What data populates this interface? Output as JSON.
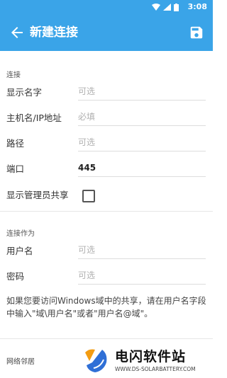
{
  "status_bar": {
    "time": "3:08"
  },
  "app_bar": {
    "title": "新建连接"
  },
  "section_connection": {
    "title": "连接",
    "display_name": {
      "label": "显示名字",
      "placeholder": "可选"
    },
    "host": {
      "label": "主机名/IP地址",
      "placeholder": "必填"
    },
    "path": {
      "label": "路径",
      "placeholder": "可选"
    },
    "port": {
      "label": "端口",
      "value": "445"
    },
    "show_admin_shares": {
      "label": "显示管理员共享",
      "checked": false
    }
  },
  "section_credentials": {
    "title": "连接作为",
    "username": {
      "label": "用户名",
      "placeholder": "可选"
    },
    "password": {
      "label": "密码",
      "placeholder": "可选"
    }
  },
  "note": "如果您要访问Windows域中的共享，请在用户名字段中输入\"域\\用户名\"或者\"用户名@域\"。",
  "bottom_section": {
    "title": "网络邻居"
  },
  "watermark": {
    "name": "电闪软件站",
    "url": "WWW.DS-SOLARBATTERY.COM"
  },
  "colors": {
    "accent": "#3aa4e8"
  }
}
